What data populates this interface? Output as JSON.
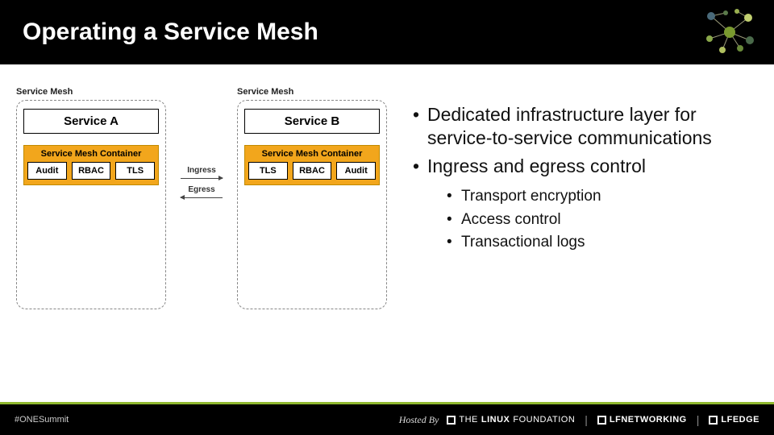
{
  "header": {
    "title": "Operating a Service Mesh"
  },
  "diagram": {
    "left": {
      "label": "Service Mesh",
      "service": "Service A",
      "containerTitle": "Service Mesh Container",
      "chips": [
        "Audit",
        "RBAC",
        "TLS"
      ]
    },
    "right": {
      "label": "Service Mesh",
      "service": "Service B",
      "containerTitle": "Service Mesh Container",
      "chips": [
        "TLS",
        "RBAC",
        "Audit"
      ]
    },
    "ingress": "Ingress",
    "egress": "Egress"
  },
  "bullets": {
    "b1": "Dedicated infrastructure layer for service-to-service communications",
    "b2": "Ingress and egress control",
    "sub": {
      "s1": "Transport encryption",
      "s2": "Access control",
      "s3": "Transactional logs"
    }
  },
  "footer": {
    "hashtag": "#ONESummit",
    "hostedBy": "Hosted By",
    "logos": {
      "linux1": "THE",
      "linux2": "LINUX",
      "linux3": "FOUNDATION",
      "net": "LFNETWORKING",
      "edge": "LFEDGE"
    }
  }
}
